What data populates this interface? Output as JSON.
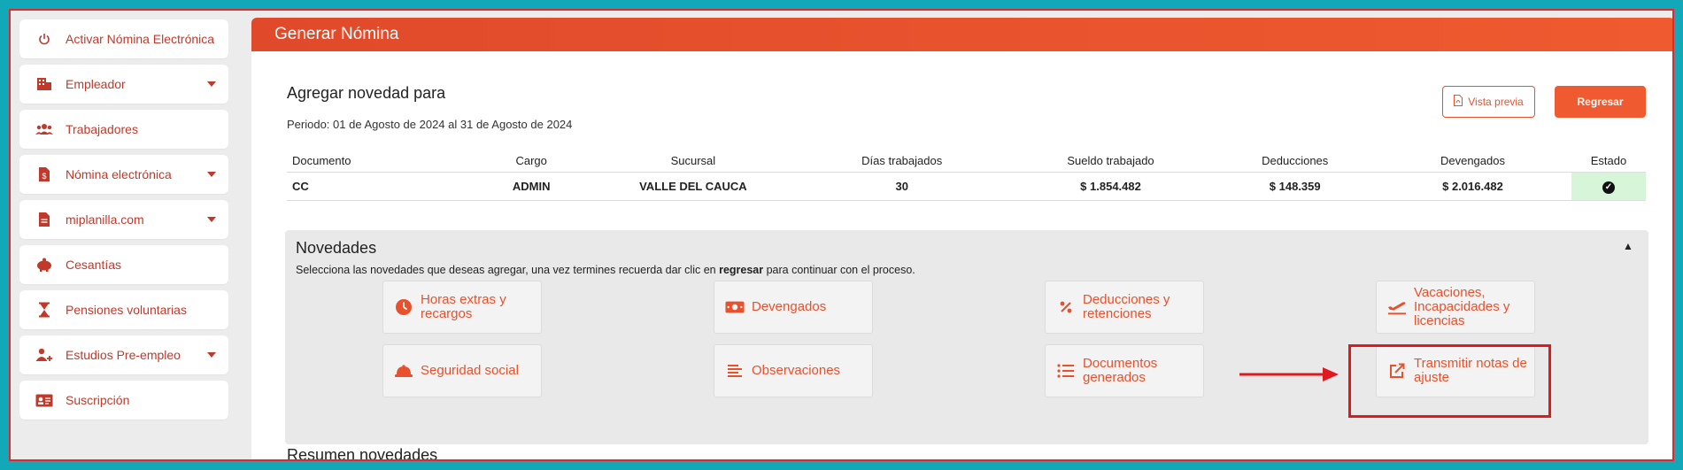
{
  "sidebar": {
    "items": [
      {
        "label": "Activar Nómina Electrónica",
        "icon": "power-icon",
        "caret": false
      },
      {
        "label": "Empleador",
        "icon": "building-icon",
        "caret": true
      },
      {
        "label": "Trabajadores",
        "icon": "users-icon",
        "caret": false
      },
      {
        "label": "Nómina electrónica",
        "icon": "invoice-dollar-icon",
        "caret": true
      },
      {
        "label": "miplanilla.com",
        "icon": "file-text-icon",
        "caret": true
      },
      {
        "label": "Cesantías",
        "icon": "piggy-bank-icon",
        "caret": false
      },
      {
        "label": "Pensiones voluntarias",
        "icon": "hourglass-icon",
        "caret": false
      },
      {
        "label": "Estudios Pre-empleo",
        "icon": "user-plus-icon",
        "caret": true
      },
      {
        "label": "Suscripción",
        "icon": "id-card-icon",
        "caret": false
      }
    ]
  },
  "header": {
    "title": "Generar Nómina"
  },
  "subtitle": "Agregar novedad para",
  "periodo": "Periodo: 01 de Agosto de 2024 al 31 de Agosto de 2024",
  "buttons": {
    "vista_previa": "Vista previa",
    "regresar": "Regresar"
  },
  "table": {
    "headers": [
      "Documento",
      "Cargo",
      "Sucursal",
      "Días trabajados",
      "Sueldo trabajado",
      "Deducciones",
      "Devengados",
      "Estado"
    ],
    "row": [
      "CC",
      "ADMIN",
      "VALLE DEL CAUCA",
      "30",
      "$ 1.854.482",
      "$ 148.359",
      "$ 2.016.482"
    ]
  },
  "novedades": {
    "title": "Novedades",
    "desc_pre": "Selecciona las novedades que deseas agregar, una vez termines recuerda dar clic en ",
    "desc_bold": "regresar",
    "desc_post": " para continuar con el proceso.",
    "cards": [
      {
        "label": "Horas extras y recargos",
        "icon": "clock-icon"
      },
      {
        "label": "Devengados",
        "icon": "money-bill-icon"
      },
      {
        "label": "Deducciones y retenciones",
        "icon": "percent-icon"
      },
      {
        "label": "Vacaciones, Incapacidades y licencias",
        "icon": "plane-departure-icon"
      },
      {
        "label": "Seguridad social",
        "icon": "hard-hat-icon"
      },
      {
        "label": "Observaciones",
        "icon": "align-left-icon"
      },
      {
        "label": "Documentos generados",
        "icon": "list-icon"
      },
      {
        "label": "Transmitir notas de ajuste",
        "icon": "external-link-icon"
      }
    ]
  },
  "resumen": "Resumen novedades",
  "colors": {
    "accent": "#f05a30",
    "sidebar_text": "#c0392b",
    "annotation": "#e0191f"
  }
}
